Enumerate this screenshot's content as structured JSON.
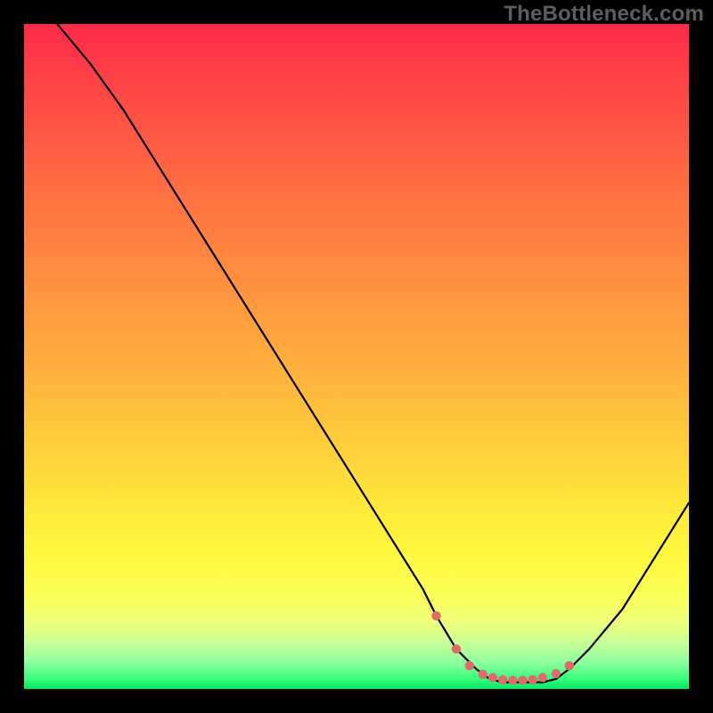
{
  "watermark": {
    "text": "TheBottleneck.com"
  },
  "chart_data": {
    "type": "line",
    "title": "",
    "xlabel": "",
    "ylabel": "",
    "xlim": [
      0,
      100
    ],
    "ylim": [
      0,
      100
    ],
    "grid": false,
    "legend": false,
    "series": [
      {
        "name": "bottleneck-curve",
        "x": [
          5,
          10,
          15,
          20,
          25,
          30,
          35,
          40,
          45,
          50,
          55,
          60,
          62,
          65,
          68,
          70,
          72,
          74,
          76,
          78,
          80,
          82,
          85,
          90,
          95,
          100
        ],
        "y": [
          100,
          94,
          87,
          79,
          71,
          63,
          55,
          47,
          39,
          31,
          23,
          15,
          11,
          6,
          3,
          1.5,
          1,
          1,
          1,
          1,
          1.5,
          3,
          6,
          12,
          20,
          28
        ]
      }
    ],
    "markers": {
      "name": "optimal-range-dots",
      "color": "#e06a6c",
      "x": [
        62,
        65,
        67,
        69,
        70.5,
        72,
        73.5,
        75,
        76.5,
        78,
        80,
        82
      ],
      "y": [
        11,
        6,
        3.5,
        2.2,
        1.7,
        1.4,
        1.3,
        1.3,
        1.4,
        1.7,
        2.3,
        3.5
      ]
    },
    "gradient_stops": [
      {
        "pos": 0,
        "color": "#ff2a49"
      },
      {
        "pos": 50,
        "color": "#ffb03d"
      },
      {
        "pos": 85,
        "color": "#fff83f"
      },
      {
        "pos": 100,
        "color": "#00e864"
      }
    ]
  }
}
